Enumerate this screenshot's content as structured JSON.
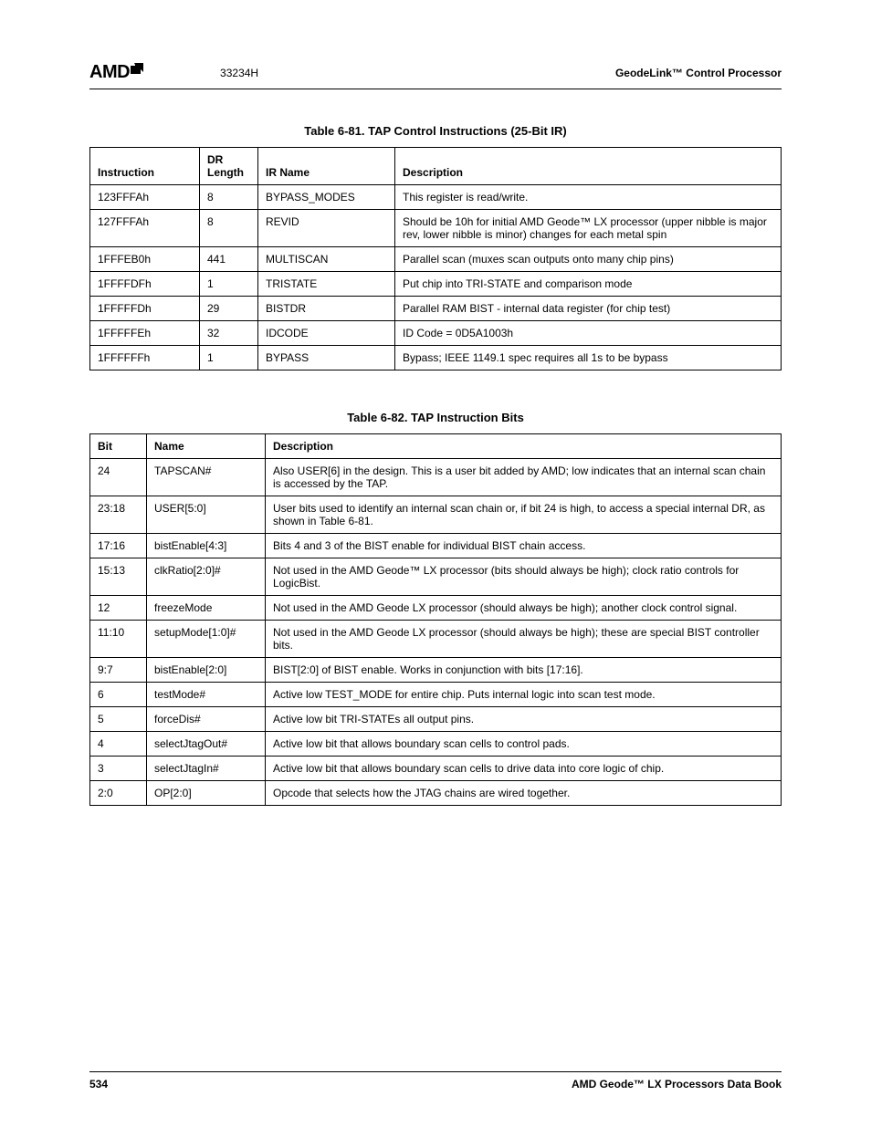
{
  "header": {
    "logo_text": "AMD",
    "doc_number": "33234H",
    "section": "GeodeLink™ Control Processor"
  },
  "table1": {
    "title": "Table 6-81.  TAP Control Instructions (25-Bit IR)",
    "headers": {
      "c0": "Instruction",
      "c1": "DR Length",
      "c2": "IR Name",
      "c3": "Description"
    },
    "rows": [
      {
        "c0": "123FFFAh",
        "c1": "8",
        "c2": "BYPASS_MODES",
        "c3": "This register is read/write."
      },
      {
        "c0": "127FFFAh",
        "c1": "8",
        "c2": "REVID",
        "c3": "Should be 10h for initial AMD Geode™ LX processor (upper nibble is major rev, lower nibble is minor) changes for each metal spin"
      },
      {
        "c0": "1FFFEB0h",
        "c1": "441",
        "c2": "MULTISCAN",
        "c3": "Parallel scan (muxes scan outputs onto many chip pins)"
      },
      {
        "c0": "1FFFFDFh",
        "c1": "1",
        "c2": "TRISTATE",
        "c3": "Put chip into TRI-STATE and comparison mode"
      },
      {
        "c0": "1FFFFFDh",
        "c1": "29",
        "c2": "BISTDR",
        "c3": "Parallel RAM BIST - internal data register (for chip test)"
      },
      {
        "c0": "1FFFFFEh",
        "c1": "32",
        "c2": "IDCODE",
        "c3": "ID Code = 0D5A1003h"
      },
      {
        "c0": "1FFFFFFh",
        "c1": "1",
        "c2": "BYPASS",
        "c3": "Bypass; IEEE 1149.1 spec requires all 1s to be bypass"
      }
    ]
  },
  "table2": {
    "title": "Table 6-82.  TAP Instruction Bits",
    "headers": {
      "c0": "Bit",
      "c1": "Name",
      "c2": "Description"
    },
    "rows": [
      {
        "c0": "24",
        "c1": "TAPSCAN#",
        "c2": "Also USER[6] in the design. This is a user bit added by AMD; low indicates that an internal scan chain is accessed by the TAP."
      },
      {
        "c0": "23:18",
        "c1": "USER[5:0]",
        "c2": "User bits used to identify an internal scan chain or, if bit 24 is high, to access a special internal DR, as shown in Table 6-81."
      },
      {
        "c0": "17:16",
        "c1": "bistEnable[4:3]",
        "c2": "Bits 4 and 3 of the BIST enable for individual BIST chain access."
      },
      {
        "c0": "15:13",
        "c1": "clkRatio[2:0]#",
        "c2": "Not used in the AMD Geode™ LX processor (bits should always be high); clock ratio controls for LogicBist."
      },
      {
        "c0": "12",
        "c1": "freezeMode",
        "c2": "Not used in the AMD Geode LX processor (should always be high); another clock control signal."
      },
      {
        "c0": "11:10",
        "c1": "setupMode[1:0]#",
        "c2": "Not used in the AMD Geode LX processor (should always be high); these are special BIST controller bits."
      },
      {
        "c0": "9:7",
        "c1": "bistEnable[2:0]",
        "c2": "BIST[2:0] of BIST enable. Works in conjunction with bits [17:16]."
      },
      {
        "c0": "6",
        "c1": "testMode#",
        "c2": "Active low TEST_MODE for entire chip. Puts internal logic into scan test mode."
      },
      {
        "c0": "5",
        "c1": "forceDis#",
        "c2": "Active low bit TRI-STATEs all output pins."
      },
      {
        "c0": "4",
        "c1": "selectJtagOut#",
        "c2": "Active low bit that allows boundary scan cells to control pads."
      },
      {
        "c0": "3",
        "c1": "selectJtagIn#",
        "c2": "Active low bit that allows boundary scan cells to drive data into core logic of chip."
      },
      {
        "c0": "2:0",
        "c1": "OP[2:0]",
        "c2": "Opcode that selects how the JTAG chains are wired together."
      }
    ]
  },
  "footer": {
    "page": "534",
    "book": "AMD Geode™ LX Processors Data Book"
  }
}
